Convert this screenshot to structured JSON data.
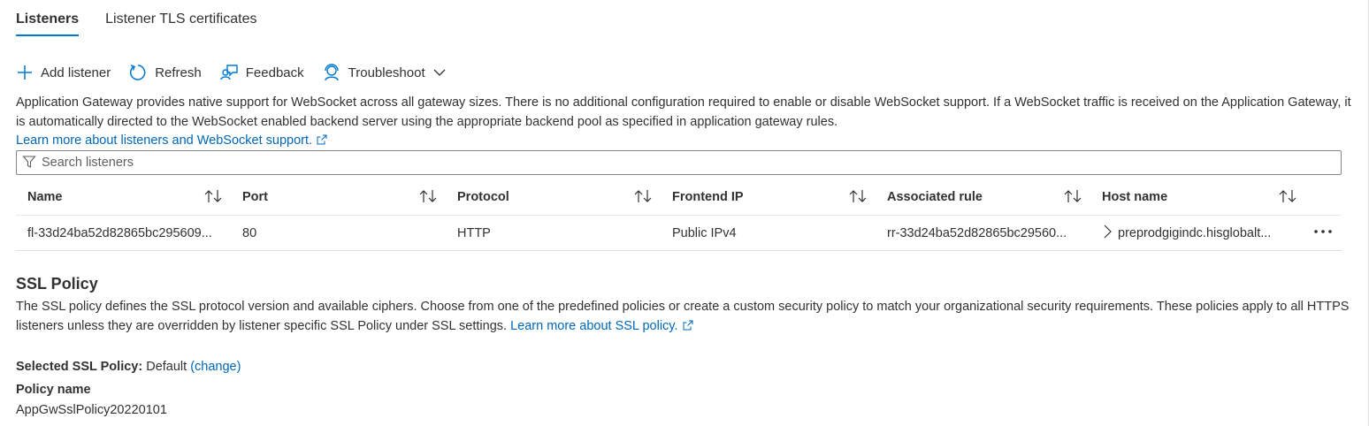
{
  "tabs": [
    {
      "label": "Listeners",
      "active": true
    },
    {
      "label": "Listener TLS certificates",
      "active": false
    }
  ],
  "toolbar": {
    "add_listener": "Add listener",
    "refresh": "Refresh",
    "feedback": "Feedback",
    "troubleshoot": "Troubleshoot"
  },
  "description": {
    "text": "Application Gateway provides native support for WebSocket across all gateway sizes. There is no additional configuration required to enable or disable WebSocket support. If a WebSocket traffic is received on the Application Gateway, it is automatically directed to the WebSocket enabled backend server using the appropriate backend pool as specified in application gateway rules.",
    "learn_more": "Learn more about listeners and WebSocket support."
  },
  "search": {
    "placeholder": "Search listeners"
  },
  "table": {
    "columns": [
      "Name",
      "Port",
      "Protocol",
      "Frontend IP",
      "Associated rule",
      "Host name"
    ],
    "rows": [
      {
        "name": "fl-33d24ba52d82865bc295609...",
        "port": "80",
        "protocol": "HTTP",
        "frontend_ip": "Public IPv4",
        "associated_rule": "rr-33d24ba52d82865bc29560...",
        "host_name": "preprodgigindc.hisglobalt..."
      }
    ]
  },
  "ssl": {
    "title": "SSL Policy",
    "description": "The SSL policy defines the SSL protocol version and available ciphers. Choose from one of the predefined policies or create a custom security policy to match your organizational security requirements. These policies apply to all HTTPS listeners unless they are overridden by listener specific SSL Policy under SSL settings.",
    "learn_more": "Learn more about SSL policy.",
    "selected_label": "Selected SSL Policy:",
    "selected_value": "Default",
    "change_link": "(change)",
    "policy_name_label": "Policy name",
    "policy_name_value": "AppGwSslPolicy20220101"
  },
  "icons": {
    "add": "plus-icon",
    "refresh": "refresh-icon",
    "feedback": "feedback-icon",
    "troubleshoot": "troubleshoot-icon",
    "chevron": "chevron-down-icon",
    "filter": "filter-icon",
    "sort": "sort-icon",
    "expand": "chevron-right-icon",
    "more": "more-icon",
    "external": "external-link-icon"
  },
  "colors": {
    "accent": "#0078d4",
    "link": "#0067b8",
    "text": "#323130"
  }
}
